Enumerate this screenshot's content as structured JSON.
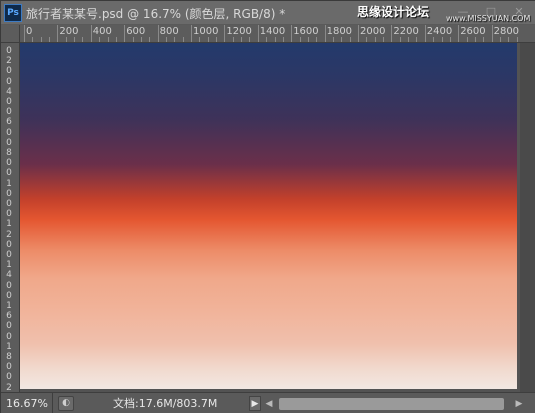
{
  "window": {
    "app_badge": "Ps",
    "title": "旅行者某某号.psd @ 16.7% (颜色层, RGB/8) *"
  },
  "watermark": {
    "text": "思缘设计论坛",
    "url": "www.MISSYUAN.COM"
  },
  "ruler": {
    "top_labels": [
      "0",
      "200",
      "400",
      "600",
      "800",
      "1000",
      "1200",
      "1400",
      "1600",
      "1800",
      "2000",
      "2200",
      "2400",
      "2600",
      "2800"
    ],
    "left_labels": [
      "0",
      "2",
      "0",
      "0",
      "4",
      "0",
      "0",
      "6",
      "0",
      "0",
      "8",
      "0",
      "0",
      "1",
      "0",
      "0",
      "0",
      "1",
      "2",
      "0",
      "0",
      "1",
      "4",
      "0",
      "0",
      "1",
      "6",
      "0",
      "0",
      "1",
      "8",
      "0",
      "0",
      "2"
    ]
  },
  "canvas": {
    "layer": "颜色层",
    "gradient_colors": [
      "#233a6c",
      "#3e3259",
      "#6a2f4a",
      "#e45630",
      "#ed8c68",
      "#f0a88a",
      "#f1b49b",
      "#f2e8e3"
    ]
  },
  "status": {
    "zoom": "16.67%",
    "doc_info": "文档:17.6M/803.7M"
  },
  "icons": {
    "ps": "photoshop-app-icon",
    "minimize": "minimize-icon",
    "maximize": "maximize-icon",
    "close": "close-icon",
    "status_menu": "status-menu-arrow-icon",
    "scroll_left": "scroll-left-icon",
    "scroll_right": "scroll-right-icon"
  }
}
